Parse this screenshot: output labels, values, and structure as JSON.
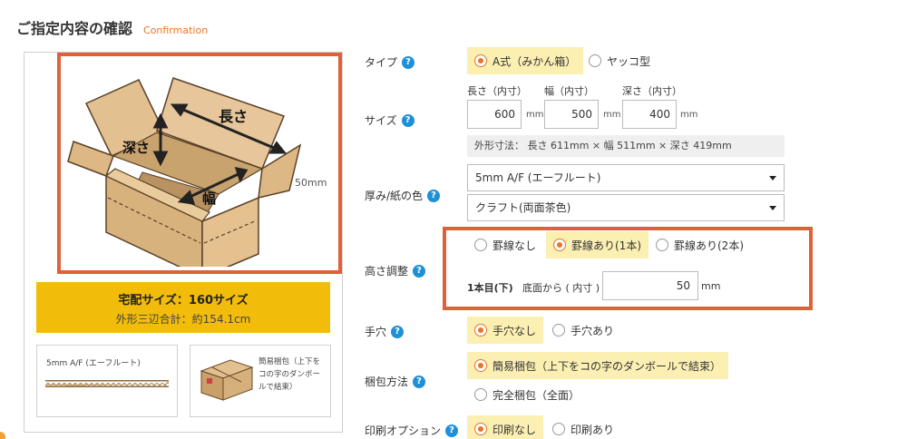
{
  "header": {
    "title": "ご指定内容の確認",
    "subtitle": "Confirmation"
  },
  "preview": {
    "labels": {
      "length": "長さ",
      "depth": "深さ",
      "width": "幅"
    },
    "thickness": "50mm",
    "delivery_size": "宅配サイズ：160サイズ",
    "outer_total": "外形三辺合計：約154.1cm",
    "flute_card": "5mm A/F (エーフルート)",
    "pack_card_text": "簡易梱包（上下をコの字のダンボールで結束）"
  },
  "form": {
    "type": {
      "label": "タイプ",
      "options": [
        "A式（みかん箱）",
        "ヤッコ型"
      ],
      "selected": "A式（みかん箱）"
    },
    "size": {
      "label": "サイズ",
      "length_label": "長さ（内寸）",
      "width_label": "幅（内寸）",
      "depth_label": "深さ（内寸）",
      "length": "600",
      "width": "500",
      "depth": "400",
      "unit": "mm",
      "outer": "外形寸法： 長さ 611mm × 幅 511mm × 深さ 419mm"
    },
    "thickness": {
      "label": "厚み/紙の色",
      "flute": "5mm A/F (エーフルート)",
      "color": "クラフト(両面茶色)"
    },
    "height_adjust": {
      "label": "高さ調整",
      "options": [
        "罫線なし",
        "罫線あり(1本)",
        "罫線あり(2本)"
      ],
      "selected": "罫線あり(1本)",
      "line_label": "1本目(下)",
      "from_label": "底面から ( 内寸 )",
      "value": "50",
      "unit": "mm"
    },
    "handhole": {
      "label": "手穴",
      "options": [
        "手穴なし",
        "手穴あり"
      ],
      "selected": "手穴なし"
    },
    "packing": {
      "label": "梱包方法",
      "options": [
        "簡易梱包（上下をコの字のダンボールで結束）",
        "完全梱包（全面）"
      ],
      "selected": "簡易梱包（上下をコの字のダンボールで結束）"
    },
    "print": {
      "label": "印刷オプション",
      "options": [
        "印刷なし",
        "印刷あり"
      ],
      "selected": "印刷なし"
    }
  },
  "colors": {
    "accent": "#e8742c",
    "highlight_frame": "#e0603a",
    "banner": "#f2bc0a",
    "selected_bg": "#fbefb2",
    "help": "#1e90d8"
  }
}
